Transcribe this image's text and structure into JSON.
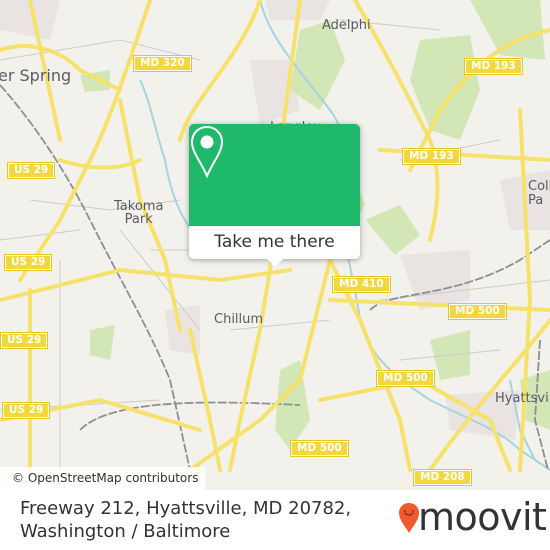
{
  "map": {
    "place_labels": [
      {
        "id": "silver-spring",
        "text": "er Spring"
      },
      {
        "id": "adelphi",
        "text": "Adelphi"
      },
      {
        "id": "langley",
        "text": "Langley"
      },
      {
        "id": "takoma-park",
        "text": "Takoma\nPark"
      },
      {
        "id": "chillum",
        "text": "Chillum"
      },
      {
        "id": "college-park",
        "text": "Coll\nPa"
      },
      {
        "id": "hyattsville",
        "text": "Hyattsvil"
      }
    ],
    "road_shields": [
      {
        "id": "md320",
        "text": "MD 320"
      },
      {
        "id": "md193-a",
        "text": "MD 193"
      },
      {
        "id": "md193-b",
        "text": "MD 193"
      },
      {
        "id": "us29-a",
        "text": "US 29"
      },
      {
        "id": "us29-b",
        "text": "US 29"
      },
      {
        "id": "us29-c",
        "text": "US 29"
      },
      {
        "id": "us29-d",
        "text": "US 29"
      },
      {
        "id": "md410",
        "text": "MD 410"
      },
      {
        "id": "md500-a",
        "text": "MD 500"
      },
      {
        "id": "md500-b",
        "text": "MD 500"
      },
      {
        "id": "md500-c",
        "text": "MD 500"
      },
      {
        "id": "md208",
        "text": "MD 208"
      }
    ],
    "attribution": "© OpenStreetMap contributors",
    "colors": {
      "land": "#f2f1ec",
      "park": "#d4e8b5",
      "water": "#a6d4e0",
      "road": "#f6e26a",
      "shield": "#f2d83a",
      "urban": "#e8e2e0"
    }
  },
  "popup": {
    "icon": "location-pin-icon",
    "button_label": "Take me there",
    "accent_color": "#1fb96b"
  },
  "footer": {
    "address": "Freeway 212, Hyattsville, MD 20782, Washington / Baltimore",
    "brand": "moovit",
    "brand_color": "#f0592b"
  }
}
